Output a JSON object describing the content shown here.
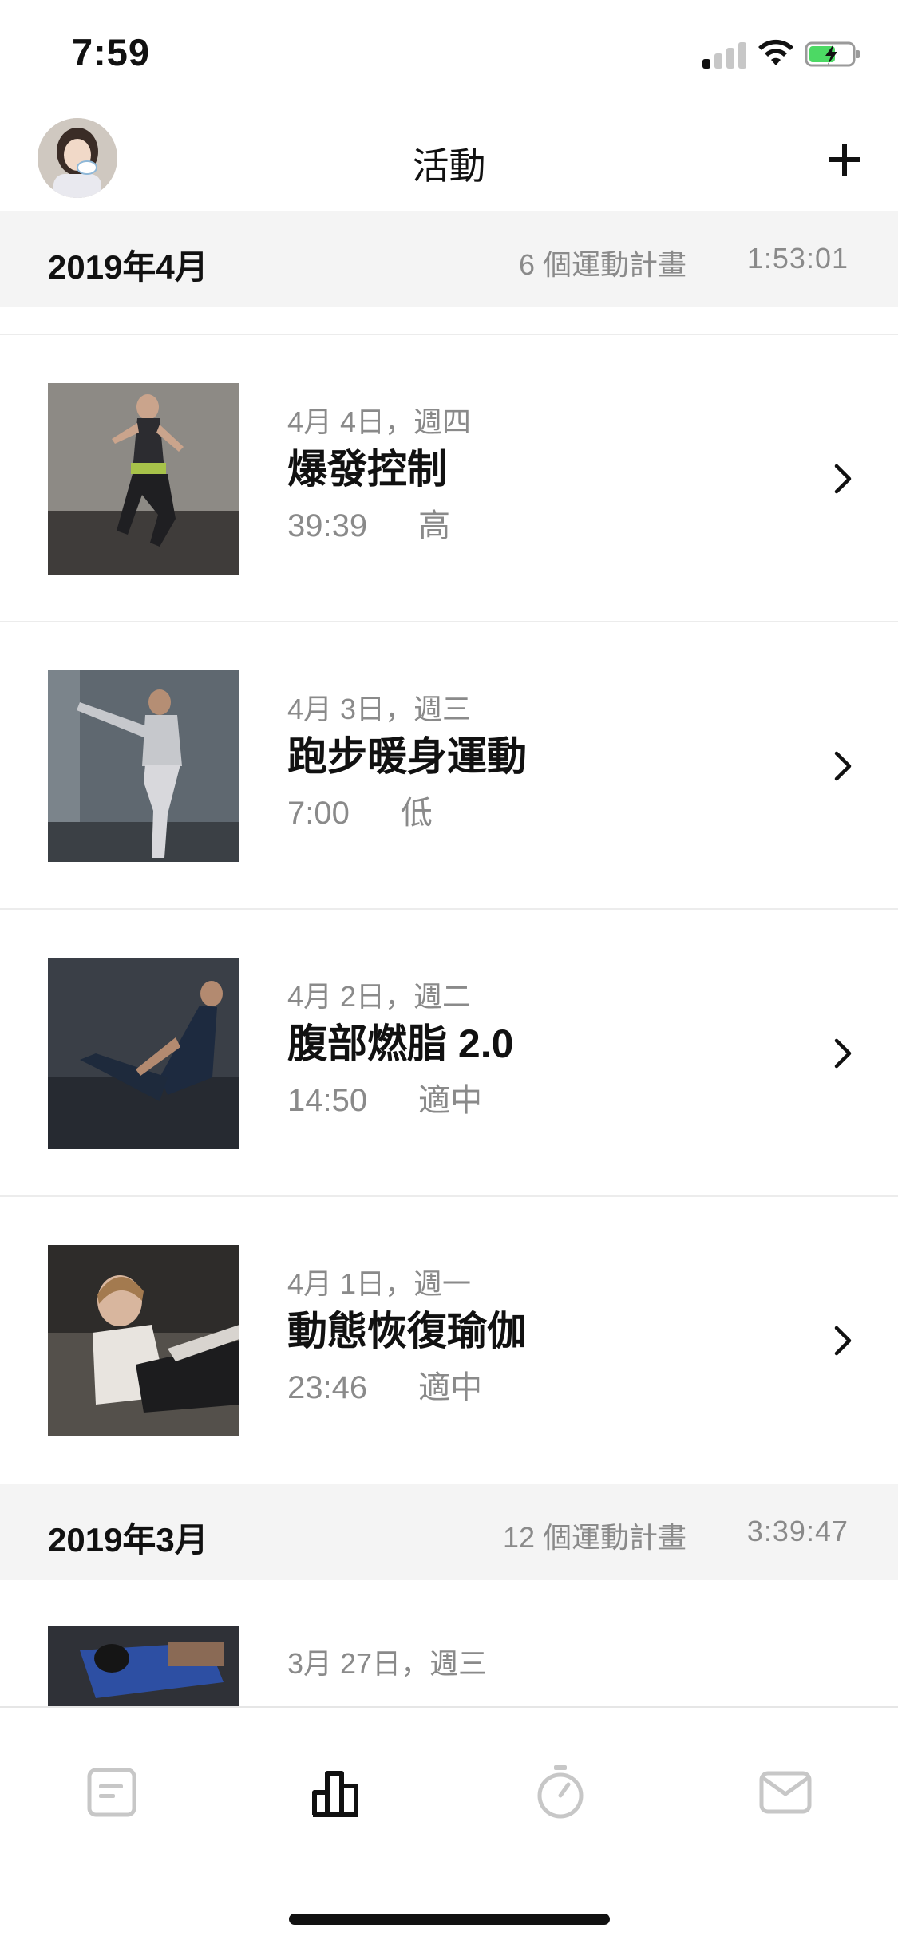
{
  "status_bar": {
    "time": "7:59",
    "signal_bars": 1,
    "battery_charging": true
  },
  "header": {
    "title": "活動",
    "avatar_icon": "profile-photo",
    "add_icon": "plus-icon"
  },
  "months": [
    {
      "title": "2019年4月",
      "count": "6 個運動計畫",
      "duration": "1:53:01"
    },
    {
      "title": "2019年3月",
      "count": "12 個運動計畫",
      "duration": "3:39:47"
    }
  ],
  "activities": [
    {
      "date": "4月 4日，週四",
      "title": "爆發控制",
      "time": "39:39",
      "intensity": "高"
    },
    {
      "date": "4月 3日，週三",
      "title": "跑步暖身運動",
      "time": "7:00",
      "intensity": "低"
    },
    {
      "date": "4月 2日，週二",
      "title": "腹部燃脂 2.0",
      "time": "14:50",
      "intensity": "適中"
    },
    {
      "date": "4月 1日，週一",
      "title": "動態恢復瑜伽",
      "time": "23:46",
      "intensity": "適中"
    },
    {
      "date": "3月 27日，週三",
      "title": "",
      "time": "",
      "intensity": ""
    }
  ],
  "tab_bar": {
    "tabs": [
      "feed-icon",
      "activity-chart-icon",
      "stopwatch-icon",
      "inbox-icon"
    ],
    "active_index": 1
  },
  "colors": {
    "text_primary": "#111111",
    "text_secondary": "#8a8a8a",
    "section_bg": "#f4f4f4",
    "divider": "#ececec",
    "battery_green": "#4cd964",
    "tab_inactive": "#c7c7c7"
  }
}
